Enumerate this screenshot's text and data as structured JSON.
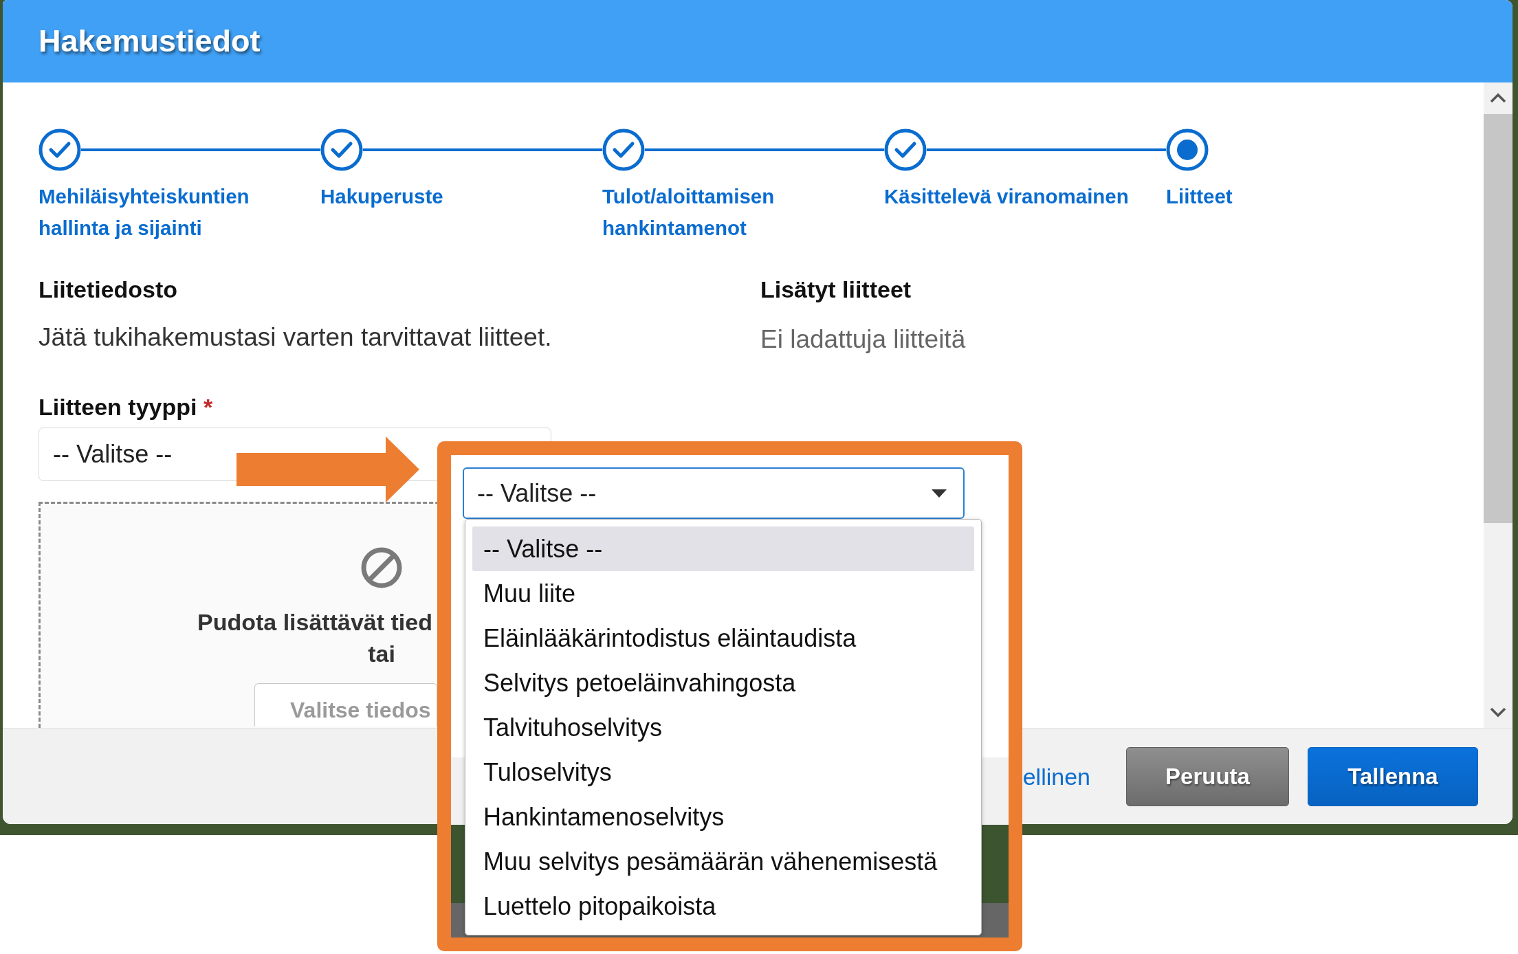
{
  "dialog": {
    "title": "Hakemustiedot"
  },
  "steps": [
    {
      "label": "Mehiläisyhteiskuntien hallinta ja sijainti",
      "completed": true
    },
    {
      "label": "Hakuperuste",
      "completed": true
    },
    {
      "label": "Tulot/aloittamisen hankintamenot",
      "completed": true
    },
    {
      "label": "Käsittelevä viranomainen",
      "completed": true
    },
    {
      "label": "Liitteet",
      "completed": false
    }
  ],
  "attachment_form": {
    "heading": "Liitetiedosto",
    "description": "Jätä tukihakemustasi varten tarvittavat liitteet.",
    "type_field": {
      "label": "Liitteen tyyppi",
      "required_mark": "*",
      "value": "-- Valitse --"
    },
    "drop_zone": {
      "text": "Pudota lisättävät tied",
      "text_2": "tai",
      "button": "Valitse tiedos"
    }
  },
  "added_attachments": {
    "heading": "Lisätyt liitteet",
    "empty_text": "Ei ladattuja liitteitä"
  },
  "footer": {
    "link": "ellinen",
    "buttons": [
      {
        "label": "Peruuta",
        "kind": "secondary"
      },
      {
        "label": "Tallenna",
        "kind": "primary"
      }
    ]
  },
  "callout": {
    "select": {
      "value": "-- Valitse --",
      "expanded": true
    },
    "options": [
      {
        "label": "-- Valitse --",
        "selected": true
      },
      {
        "label": "Muu liite",
        "selected": false
      },
      {
        "label": "Eläinlääkärintodistus eläintaudista",
        "selected": false
      },
      {
        "label": "Selvitys petoeläinvahingosta",
        "selected": false
      },
      {
        "label": "Talvituhoselvitys",
        "selected": false
      },
      {
        "label": "Tuloselvitys",
        "selected": false
      },
      {
        "label": "Hankintamenoselvitys",
        "selected": false
      },
      {
        "label": "Muu selvitys pesämäärän vähenemisestä",
        "selected": false
      },
      {
        "label": "Luettelo pitopaikoista",
        "selected": false
      }
    ]
  }
}
